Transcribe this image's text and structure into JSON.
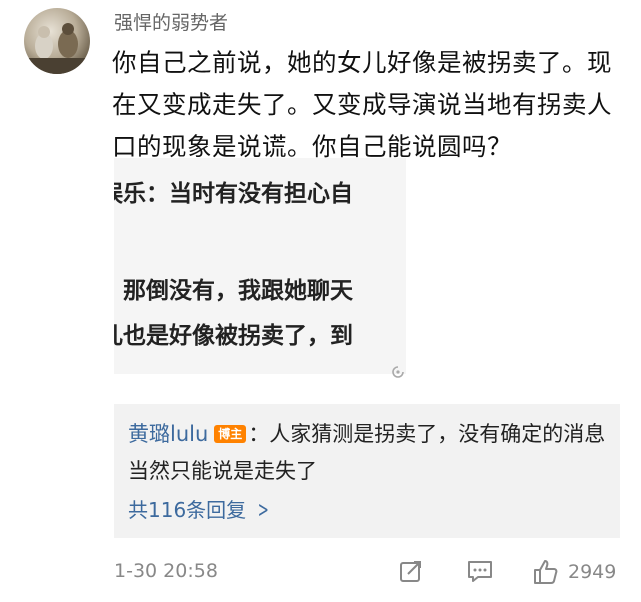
{
  "user": {
    "name": "强悍的弱势者",
    "avatar_icon": "avatar-photo-icon"
  },
  "comment": {
    "text": "你自己之前说，她的女儿好像是被拐卖了。现在又变成走失了。又变成导演说当地有拐卖人口的现象是说谎。你自己能说圆吗？"
  },
  "screenshot": {
    "lines": [
      "娱乐：当时有没有担心自",
      "：那倒没有，我跟她聊天",
      "儿也是好像被拐卖了，到"
    ]
  },
  "reply": {
    "author": "黄璐lulu",
    "badge": "博主",
    "text": "：人家猜测是拐卖了，没有确定的消息当然只能说是走失了",
    "more_label": "共116条回复"
  },
  "meta": {
    "timestamp": "1-30 20:58",
    "like_count": "2949"
  },
  "colors": {
    "link": "#3d6a9e",
    "badge": "#ff8200",
    "reply_bg": "#f2f2f2"
  }
}
